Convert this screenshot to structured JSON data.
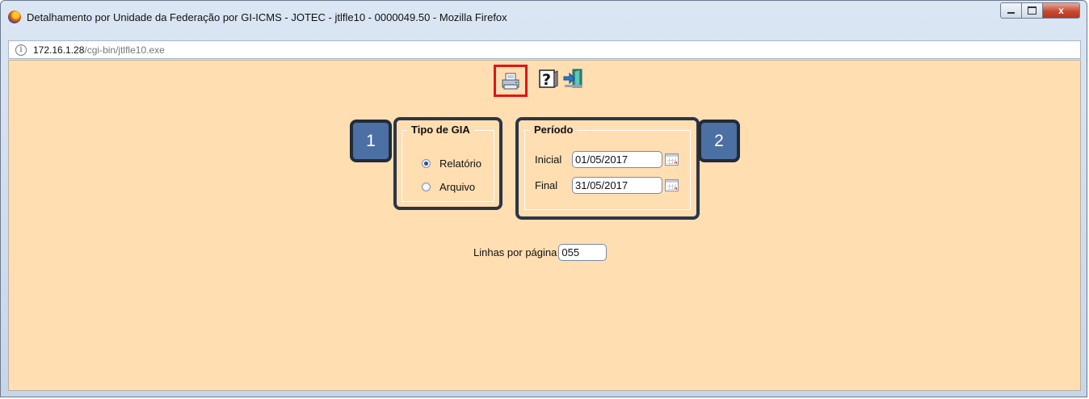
{
  "window": {
    "title": "Detalhamento por Unidade da Federação por GI-ICMS - JOTEC - jtlfle10 - 0000049.50 - Mozilla Firefox",
    "buttons": {
      "minimize_icon": "minimize-icon",
      "maximize_icon": "maximize-icon",
      "close_label": "x"
    }
  },
  "urlbar": {
    "host": "172.16.1.28",
    "path": "/cgi-bin/jtlfle10.exe",
    "info_icon": "info-icon",
    "info_glyph": "i"
  },
  "toolbar": {
    "print_icon": "printer-icon",
    "help_icon": "help-icon",
    "exit_icon": "exit-icon"
  },
  "callouts": {
    "first": "1",
    "second": "2"
  },
  "tipo_gia": {
    "legend": "Tipo de GIA",
    "options": [
      {
        "label": "Relatório",
        "checked": true
      },
      {
        "label": "Arquivo",
        "checked": false
      }
    ]
  },
  "periodo": {
    "legend": "Período",
    "inicial_label": "Inicial",
    "inicial_value": "01/05/2017",
    "final_label": "Final",
    "final_value": "31/05/2017",
    "calendar_icon": "calendar-icon"
  },
  "linhas": {
    "label": "Linhas por página",
    "value": "055"
  },
  "colors": {
    "content_bg": "#ffdeb2",
    "highlight_red": "#e11515",
    "callout_blue": "#4c6fa4"
  }
}
